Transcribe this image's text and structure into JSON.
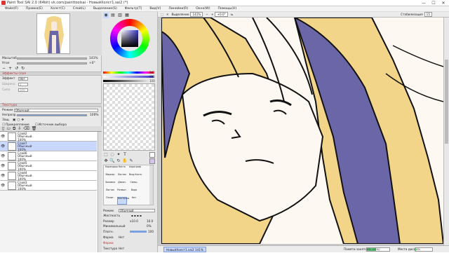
{
  "title": "Paint Tool SAI 2.0 (64bit) vk.com/painttoolsai - НовыйХолст1.sai2 (*)",
  "window_controls": {
    "minimize": "—",
    "maximize": "☐",
    "close": "✕"
  },
  "menu": [
    "Файл(F)",
    "Правка(E)",
    "Холст(C)",
    "Слой(L)",
    "Выделение(S)",
    "Фильтр(T)",
    "Вид(V)",
    "Линейки(R)",
    "Окно(W)",
    "Помощь(H)"
  ],
  "navigator": {
    "zoom_label": "Масштаб",
    "zoom_value": "141%",
    "angle_label": "Угол",
    "angle_value": "+0°"
  },
  "layer_effects": {
    "header": "Эффекты слоя",
    "effect_label": "Эффект",
    "effect_value": "Нет",
    "width_label": "Ширина",
    "width_value": "1",
    "strength_label": "Сила",
    "strength_value": "100"
  },
  "texture": {
    "header": "Текстура",
    "mode_label": "Режим",
    "mode_value": "Обычный",
    "opacity_label": "Непрозр.",
    "opacity_value": "100%",
    "lock_label": "Защ.",
    "clip_label": "Прикрепление",
    "source_label": "Источник выбора"
  },
  "layers": [
    {
      "name": "Слой2",
      "mode": "Обычный",
      "opacity": "100%",
      "selected": false
    },
    {
      "name": "Слой7",
      "mode": "Обычный",
      "opacity": "100%",
      "selected": true
    },
    {
      "name": "Слой6",
      "mode": "Обычный",
      "opacity": "100%",
      "selected": false
    },
    {
      "name": "Слой5",
      "mode": "Обычный",
      "opacity": "100%",
      "selected": false
    },
    {
      "name": "Слой4",
      "mode": "Обычный",
      "opacity": "100%",
      "selected": false
    },
    {
      "name": "Слой3",
      "mode": "Обычный",
      "opacity": "100%",
      "selected": false
    }
  ],
  "color": {
    "r": "243",
    "g": "000",
    "b": "100",
    "r_label": "H",
    "g_label": "S",
    "b_label": "V",
    "current": "#3b37c4"
  },
  "brushes": [
    [
      "Карандаш",
      "Кисть",
      "Аэрограф"
    ],
    [
      "Маркер",
      "Ластик",
      "Выд.Кисть"
    ],
    [
      "Заливка",
      "Двоич.",
      "Смеш."
    ],
    [
      "Ластик",
      "Размыт.",
      "Вода"
    ],
    [
      "Палит.",
      "Кисточка",
      "Нет"
    ]
  ],
  "brush_props": {
    "mode_label": "Режим",
    "mode_value": "Обычный",
    "hardness_label": "Жесткость",
    "size_label": "Размер",
    "size_mult": "x10.0",
    "size_value": "10.0",
    "min_size_label": "Минимальный",
    "min_size_value": "0%",
    "density_label": "Плотн.",
    "density_value": "100",
    "shape_label": "Форма",
    "shape_value": "Нет",
    "texture_label": "Текстура",
    "texture_value": "Нет",
    "form_header": "Форма"
  },
  "viewbar": {
    "select_label": "Выделение",
    "zoom": "141%",
    "angle": "+0.0°",
    "stab_label": "Стабилизация",
    "stab_value": "15"
  },
  "status": {
    "tab": "НовыйХолст1.sai2",
    "tab_zoom": "141%",
    "memory_label": "Памяти занято",
    "memory_value": "5% (41%)",
    "memory_pct": 0.41,
    "disk_label": "Места диска",
    "disk_value": "4%",
    "disk_pct": 0.04
  }
}
